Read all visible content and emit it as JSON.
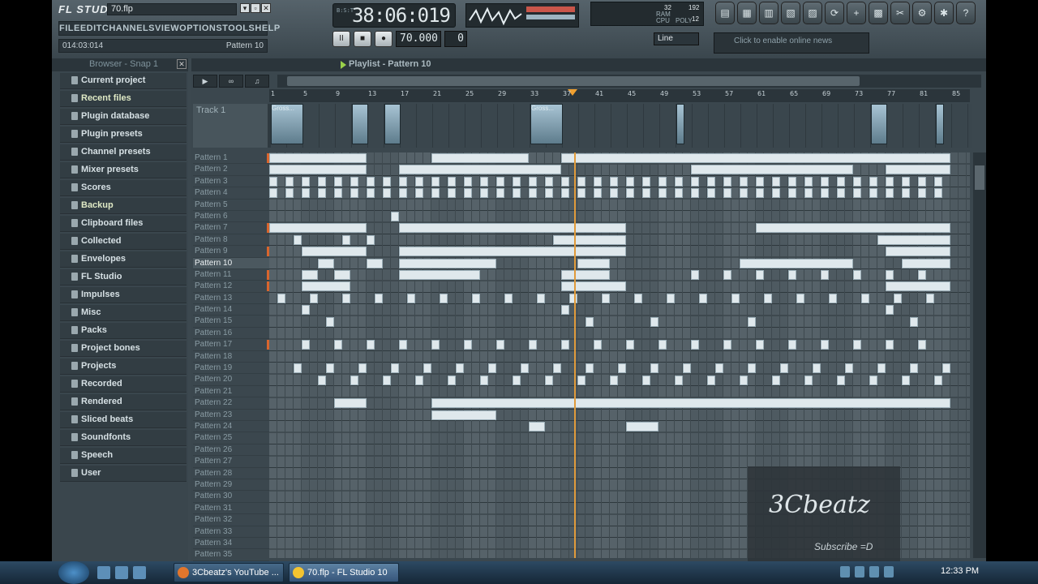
{
  "app": {
    "logo": "FL STUDIO",
    "file_name": "70.flp",
    "win_btns": [
      "▾",
      "▫",
      "✕"
    ]
  },
  "menu": [
    "FILE",
    "EDIT",
    "CHANNELS",
    "VIEW",
    "OPTIONS",
    "TOOLS",
    "HELP"
  ],
  "hint": {
    "position": "014:03:014",
    "pattern": "Pattern 10"
  },
  "lcd": {
    "time": "38:06:019",
    "labels": "B:S:T"
  },
  "cpu": {
    "ram": "32",
    "poly_max": "192",
    "poly": "12",
    "labels": [
      "RAM",
      "CPU",
      "POLY"
    ]
  },
  "transport": {
    "pause": "II",
    "stop": "■",
    "record": "●",
    "tempo": "70.000",
    "pattern_num": "0"
  },
  "line_mode": "Line",
  "news": "Click to enable online news",
  "browser": {
    "title": "Browser - Snap 1",
    "items": [
      {
        "label": "Current project",
        "green": false
      },
      {
        "label": "Recent files",
        "green": true
      },
      {
        "label": "Plugin database",
        "green": false
      },
      {
        "label": "Plugin presets",
        "green": false
      },
      {
        "label": "Channel presets",
        "green": false
      },
      {
        "label": "Mixer presets",
        "green": false
      },
      {
        "label": "Scores",
        "green": false
      },
      {
        "label": "Backup",
        "green": true
      },
      {
        "label": "Clipboard files",
        "green": false
      },
      {
        "label": "Collected",
        "green": false
      },
      {
        "label": "Envelopes",
        "green": false
      },
      {
        "label": "FL Studio",
        "green": false
      },
      {
        "label": "Impulses",
        "green": false
      },
      {
        "label": "Misc",
        "green": false
      },
      {
        "label": "Packs",
        "green": false
      },
      {
        "label": "Project bones",
        "green": false
      },
      {
        "label": "Projects",
        "green": false
      },
      {
        "label": "Recorded",
        "green": false
      },
      {
        "label": "Rendered",
        "green": false
      },
      {
        "label": "Sliced beats",
        "green": false
      },
      {
        "label": "Soundfonts",
        "green": false
      },
      {
        "label": "Speech",
        "green": false
      },
      {
        "label": "User",
        "green": false
      }
    ]
  },
  "playlist": {
    "title": "Playlist - Pattern 10",
    "track_label": "Track 1",
    "ruler": [
      "1",
      "5",
      "9",
      "13",
      "17",
      "21",
      "25",
      "29",
      "33",
      "37",
      "41",
      "45",
      "49",
      "53",
      "57",
      "61",
      "65",
      "69",
      "73",
      "77",
      "81",
      "85"
    ],
    "clip_label": "Gross...",
    "patterns": [
      "Pattern 1",
      "Pattern 2",
      "Pattern 3",
      "Pattern 4",
      "Pattern 5",
      "Pattern 6",
      "Pattern 7",
      "Pattern 8",
      "Pattern 9",
      "Pattern 10",
      "Pattern 11",
      "Pattern 12",
      "Pattern 13",
      "Pattern 14",
      "Pattern 15",
      "Pattern 16",
      "Pattern 17",
      "Pattern 18",
      "Pattern 19",
      "Pattern 20",
      "Pattern 21",
      "Pattern 22",
      "Pattern 23",
      "Pattern 24",
      "Pattern 25",
      "Pattern 26",
      "Pattern 27",
      "Pattern 28",
      "Pattern 29",
      "Pattern 30",
      "Pattern 31",
      "Pattern 32",
      "Pattern 33",
      "Pattern 34",
      "Pattern 35"
    ],
    "selected": "Pattern 10"
  },
  "watermark": {
    "name": "3Cbeatz",
    "sub": "Subscribe =D"
  },
  "taskbar": {
    "tasks": [
      "3Cbeatz's YouTube ...",
      "70.flp - FL Studio 10"
    ],
    "clock": "12:33 PM"
  }
}
